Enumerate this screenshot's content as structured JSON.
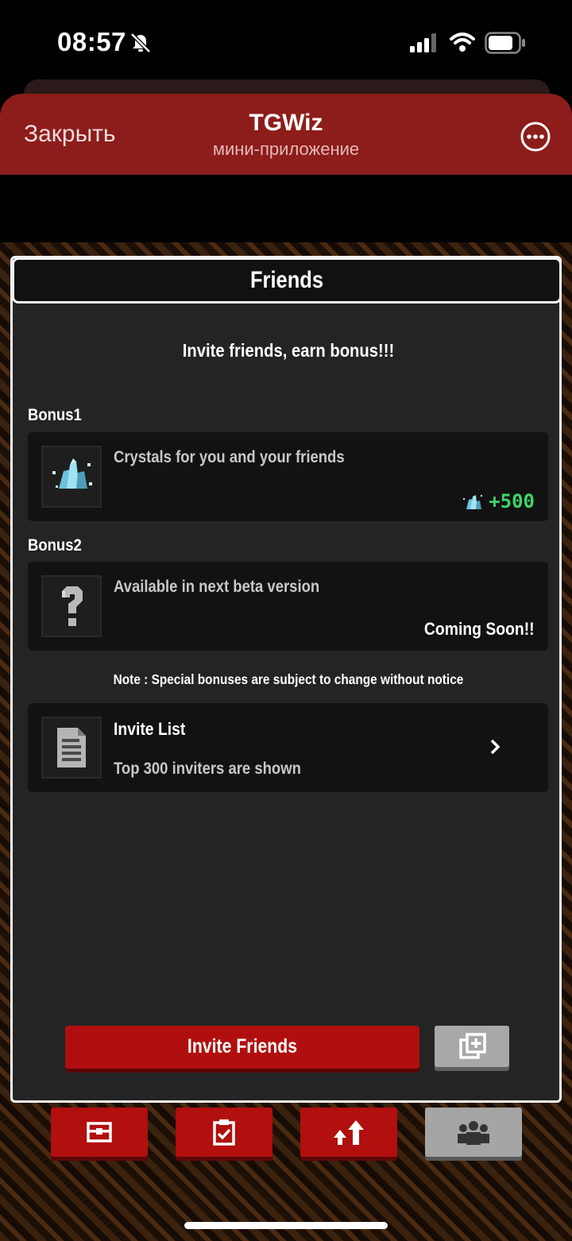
{
  "status_bar": {
    "time": "08:57",
    "icons": [
      "bell-slash-icon",
      "cellular-signal-icon",
      "wifi-icon",
      "battery-icon"
    ]
  },
  "header": {
    "close_label": "Закрыть",
    "title": "TGWiz",
    "subtitle": "мини-приложение",
    "more_icon": "ellipsis-circle-icon"
  },
  "panel": {
    "title": "Friends",
    "headline": "Invite friends, earn bonus!!!",
    "bonuses": [
      {
        "label": "Bonus1",
        "icon": "crystal-icon",
        "text": "Crystals for you and your friends",
        "reward": "+500"
      },
      {
        "label": "Bonus2",
        "icon": "question-mark-icon",
        "text": "Available in next beta version",
        "status": "Coming Soon!!"
      }
    ],
    "note": "Note : Special bonuses are subject to change without notice",
    "invite_list": {
      "icon": "document-icon",
      "title": "Invite List",
      "subtitle": "Top 300 inviters are shown"
    },
    "invite_button": "Invite Friends",
    "copy_icon": "copy-icon"
  },
  "bottom_nav": [
    {
      "icon": "chest-icon",
      "active": false
    },
    {
      "icon": "clipboard-check-icon",
      "active": false
    },
    {
      "icon": "upgrade-arrows-icon",
      "active": false
    },
    {
      "icon": "friends-icon",
      "active": true
    }
  ],
  "colors": {
    "header_red": "#8c1d1a",
    "button_red": "#b10f0f",
    "reward_green": "#3fd46a",
    "panel_bg": "#242424"
  }
}
